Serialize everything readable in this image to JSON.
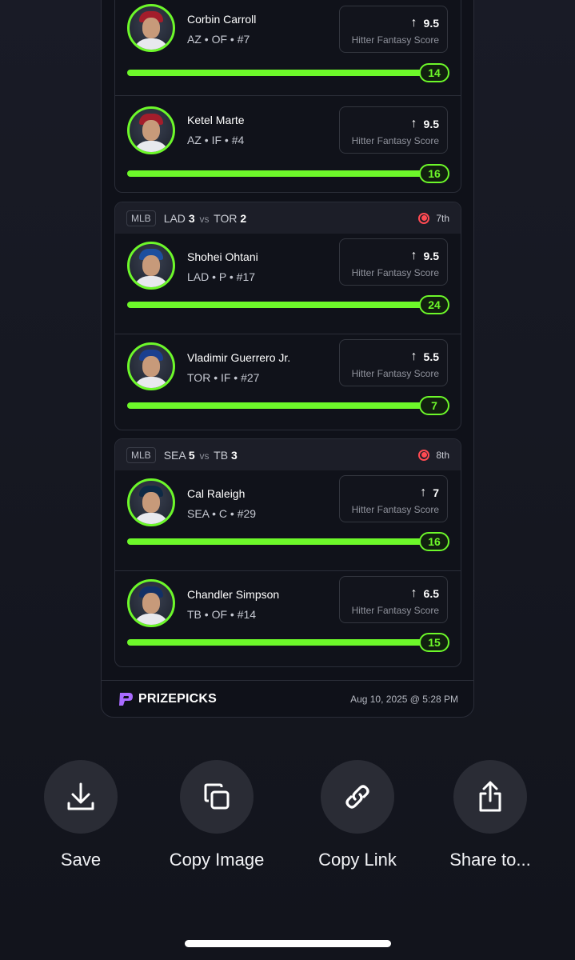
{
  "colors": {
    "accent": "#6df82a",
    "live": "#ff4a52",
    "background": "#14161f"
  },
  "groups": [
    {
      "players": [
        {
          "name": "Corbin Carroll",
          "meta": "AZ • OF • #7",
          "score": "9.5",
          "score_label": "Hitter Fantasy Score",
          "bar_value": "14",
          "cap": "#a31d2b"
        },
        {
          "name": "Ketel Marte",
          "meta": "AZ • IF • #4",
          "score": "9.5",
          "score_label": "Hitter Fantasy Score",
          "bar_value": "16",
          "cap": "#a31d2b"
        }
      ]
    },
    {
      "league": "MLB",
      "team1": "LAD",
      "score1": "3",
      "vs": "vs",
      "team2": "TOR",
      "score2": "2",
      "inning": "7th",
      "players": [
        {
          "name": "Shohei Ohtani",
          "meta": "LAD • P • #17",
          "score": "9.5",
          "score_label": "Hitter Fantasy Score",
          "bar_value": "24",
          "cap": "#1d4f9e"
        },
        {
          "name": "Vladimir Guerrero Jr.",
          "meta": "TOR • IF • #27",
          "score": "5.5",
          "score_label": "Hitter Fantasy Score",
          "bar_value": "7",
          "cap": "#1a3f8f"
        }
      ]
    },
    {
      "league": "MLB",
      "team1": "SEA",
      "score1": "5",
      "vs": "vs",
      "team2": "TB",
      "score2": "3",
      "inning": "8th",
      "players": [
        {
          "name": "Cal Raleigh",
          "meta": "SEA • C • #29",
          "score": "7",
          "score_label": "Hitter Fantasy Score",
          "bar_value": "16",
          "cap": "#0e2a45"
        },
        {
          "name": "Chandler Simpson",
          "meta": "TB • OF • #14",
          "score": "6.5",
          "score_label": "Hitter Fantasy Score",
          "bar_value": "15",
          "cap": "#123066"
        }
      ]
    }
  ],
  "footer": {
    "brand": "PRIZEPICKS",
    "date": "Aug 10, 2025 @ 5:28 PM"
  },
  "actions": [
    {
      "label": "Save",
      "icon": "download-icon"
    },
    {
      "label": "Copy Image",
      "icon": "copy-icon"
    },
    {
      "label": "Copy Link",
      "icon": "link-icon"
    },
    {
      "label": "Share to...",
      "icon": "share-icon"
    }
  ]
}
